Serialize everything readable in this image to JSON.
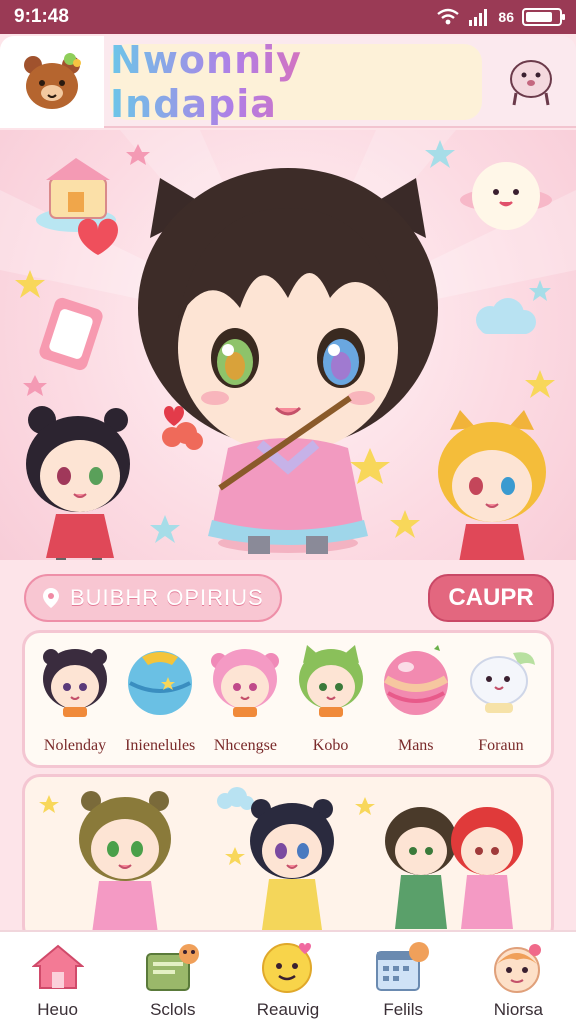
{
  "status": {
    "time": "9:1:48",
    "signal_label": "86",
    "battery_level": 0.8
  },
  "header": {
    "title": "Nwonniy Indapia",
    "left_icon": "bear-mascot-icon",
    "right_icon": "seal-mascot-icon"
  },
  "search": {
    "label": "BUIBHR OPIRIUS",
    "icon": "location-pin-icon"
  },
  "action_button": {
    "label": "CAUPR"
  },
  "categories": [
    {
      "label": "Nolenday",
      "icon": "dark-haired-girl-icon"
    },
    {
      "label": "Inienelules",
      "icon": "planet-ball-icon"
    },
    {
      "label": "Nhcengse",
      "icon": "pink-haired-girl-icon"
    },
    {
      "label": "Kobo",
      "icon": "green-cat-boy-icon"
    },
    {
      "label": "Mans",
      "icon": "pink-ball-icon"
    },
    {
      "label": "Foraun",
      "icon": "ghost-mascot-icon"
    }
  ],
  "nav": [
    {
      "label": "Heuo",
      "icon": "home-icon"
    },
    {
      "label": "Sclols",
      "icon": "map-folder-icon"
    },
    {
      "label": "Reauvig",
      "icon": "smiley-face-icon"
    },
    {
      "label": "Felils",
      "icon": "calendar-icon"
    },
    {
      "label": "Niorsa",
      "icon": "character-face-icon"
    }
  ],
  "colors": {
    "status_bar": "#9a3a55",
    "accent": "#e3677f",
    "panel_border": "#f4c6d2",
    "background": "#fde4e9"
  }
}
